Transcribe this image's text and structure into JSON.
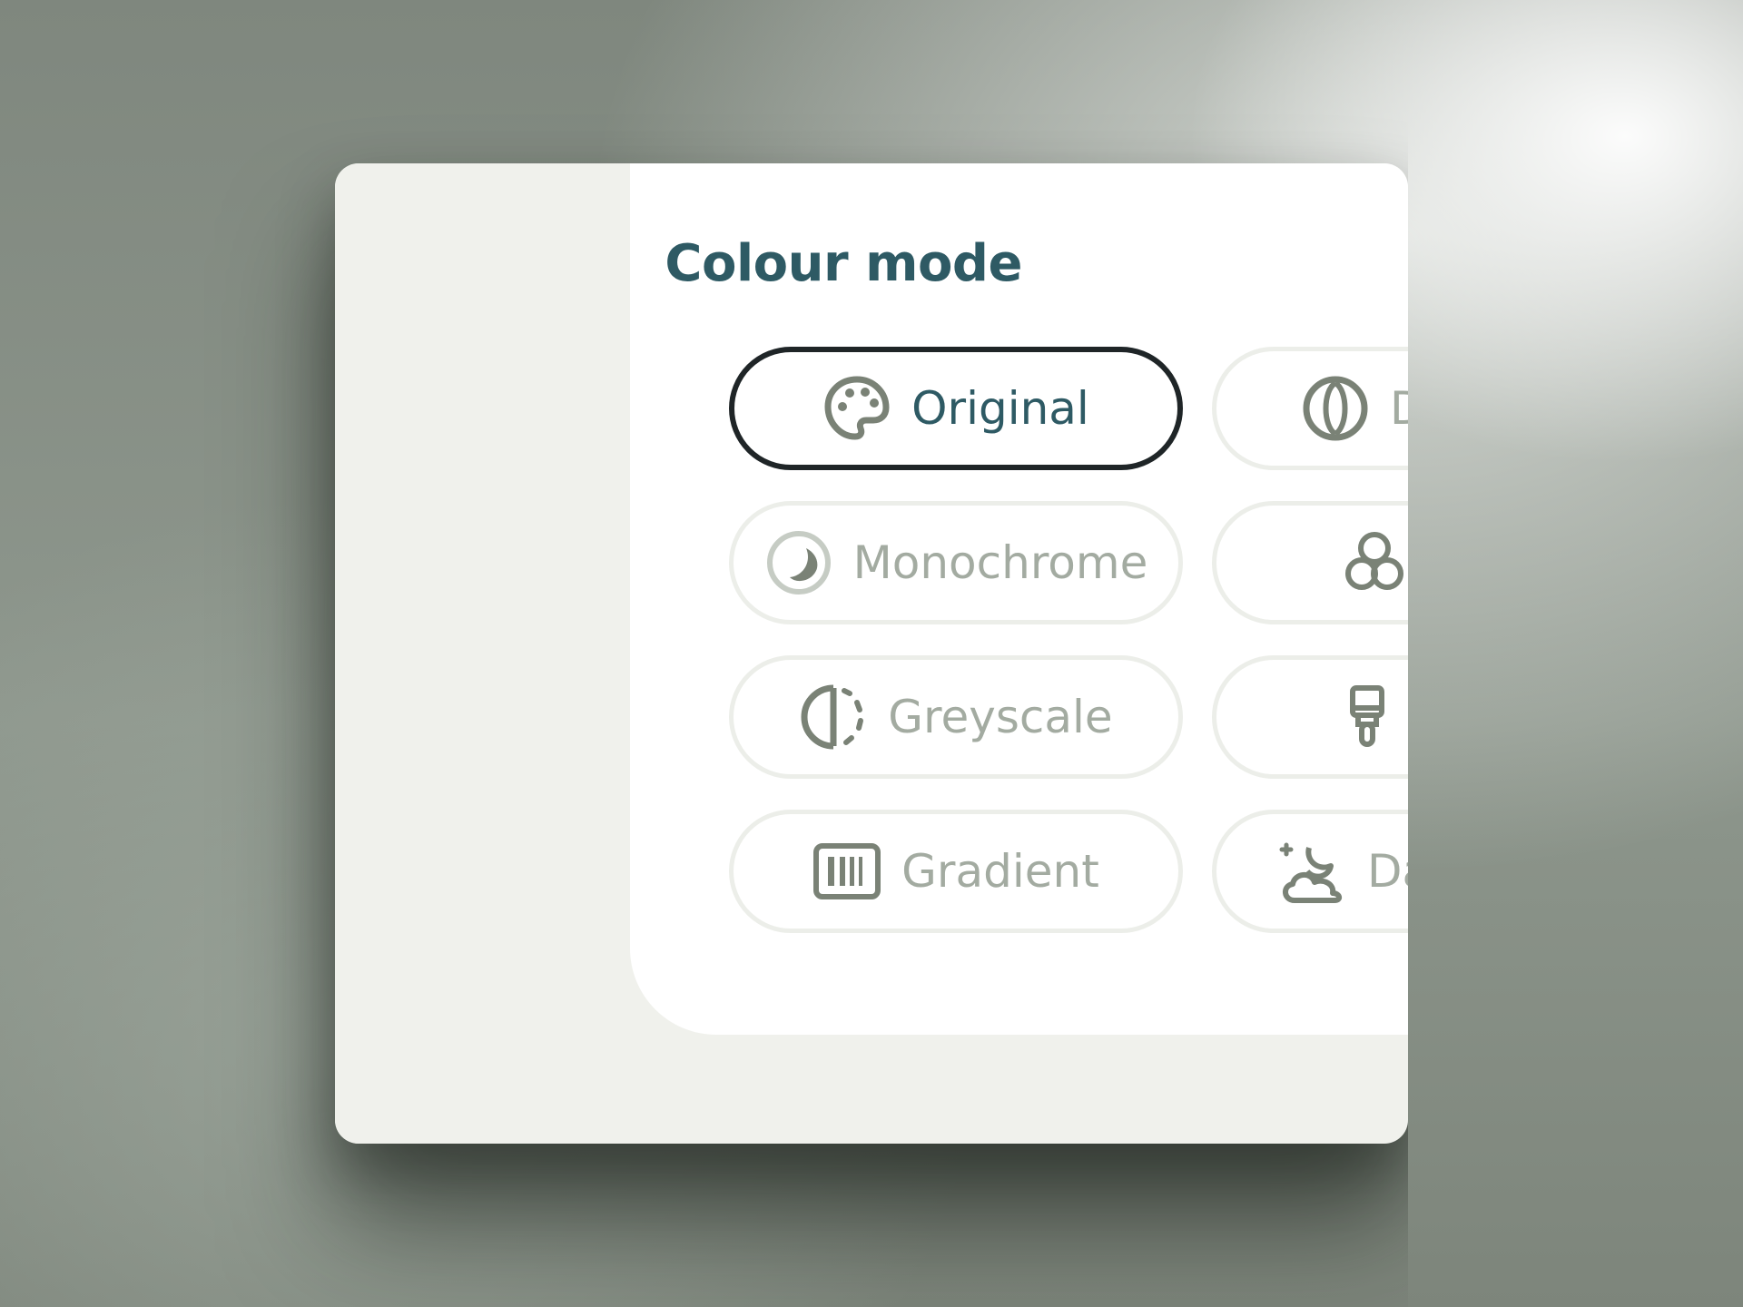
{
  "colors": {
    "accent_title": "#2e5a64",
    "chip_border": "#eceee9",
    "chip_selected_border": "#1f2527",
    "chip_text_inactive": "#a3aba1",
    "icon_color": "#7a8276",
    "panel_background": "#f0f1ec",
    "content_background": "#ffffff"
  },
  "dialog": {
    "title": "Colour mode"
  },
  "modes": {
    "left": [
      {
        "label": "Original",
        "icon": "palette-icon",
        "selected": true
      },
      {
        "label": "Monochrome",
        "icon": "moon-circle-icon",
        "selected": false
      },
      {
        "label": "Greyscale",
        "icon": "half-contrast-icon",
        "selected": false
      },
      {
        "label": "Gradient",
        "icon": "gradient-bars-icon",
        "selected": false
      }
    ],
    "right": [
      {
        "label": "D",
        "icon": "contrast-circle-icon",
        "selected": false
      },
      {
        "label": "",
        "icon": "color-circles-icon",
        "selected": false
      },
      {
        "label": "",
        "icon": "paint-brush-icon",
        "selected": false
      },
      {
        "label": "Da",
        "icon": "cloud-night-icon",
        "selected": false
      }
    ]
  }
}
